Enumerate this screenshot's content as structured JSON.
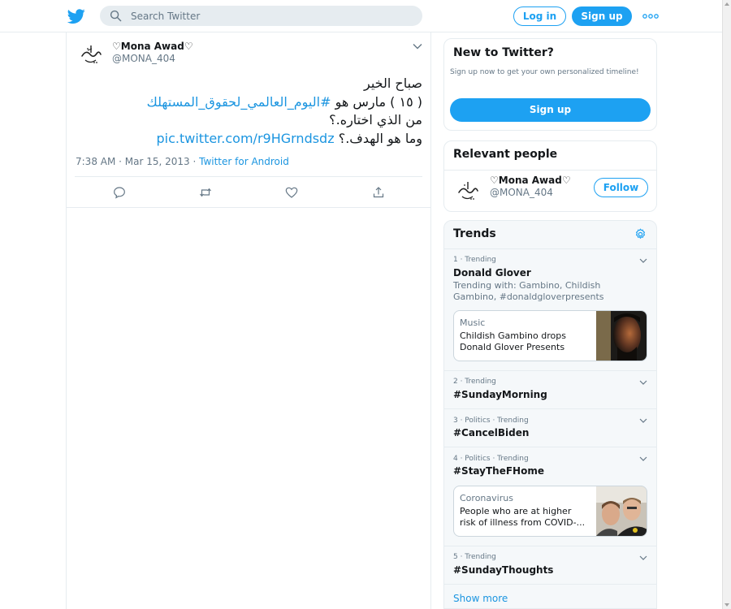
{
  "colors": {
    "brand": "#1da1f2",
    "link": "#1b95e0",
    "muted": "#657786",
    "text": "#14171a",
    "border": "#e6ecf0"
  },
  "header": {
    "logo_icon": "twitter-bird-icon",
    "search": {
      "placeholder": "Search Twitter",
      "value": ""
    },
    "login_label": "Log in",
    "signup_label": "Sign up",
    "more_icon": "more-dots-icon"
  },
  "tweet": {
    "author_name": "♡Mona Awad♡",
    "author_handle": "@MONA_404",
    "lines": {
      "l1": "صباح الخير",
      "l2_pre": "( ١٥ ) مارس هو ",
      "l2_link": "#اليوم_العالمي_لحقوق_المستهلك",
      "l3": "من الذي اختاره.؟",
      "l4_pre": "وما هو الهدف.؟ ",
      "l4_link": "pic.twitter.com/r9HGrndsdz"
    },
    "time": "7:38 AM · Mar 15, 2013 · ",
    "source": "Twitter for Android",
    "actions": [
      "reply-icon",
      "retweet-icon",
      "like-icon",
      "share-icon"
    ]
  },
  "sidebar": {
    "new_to_twitter": {
      "title": "New to Twitter?",
      "description": "Sign up now to get your own personalized timeline!",
      "button": "Sign up"
    },
    "relevant_people": {
      "title": "Relevant people",
      "name": "♡Mona Awad♡",
      "handle": "@MONA_404",
      "follow_label": "Follow"
    },
    "trends": {
      "title": "Trends",
      "items": [
        {
          "meta": "1 · Trending",
          "name": "Donald Glover",
          "trending_with": "Trending with: Gambino, Childish Gambino, #donaldgloverpresents",
          "news": {
            "category": "Music",
            "headline_1": "Childish Gambino drops",
            "headline_2": "Donald Glover Presents"
          }
        },
        {
          "meta": "2 · Trending",
          "name": "#SundayMorning"
        },
        {
          "meta": "3 · Politics · Trending",
          "name": "#CancelBiden"
        },
        {
          "meta": "4 · Politics · Trending",
          "name": "#StayTheFHome",
          "news": {
            "category": "Coronavirus",
            "headline_1": "People who are at higher",
            "headline_2": "risk of illness from COVID-..."
          }
        },
        {
          "meta": "5 · Trending",
          "name": "#SundayThoughts"
        }
      ],
      "show_more": "Show more"
    }
  }
}
